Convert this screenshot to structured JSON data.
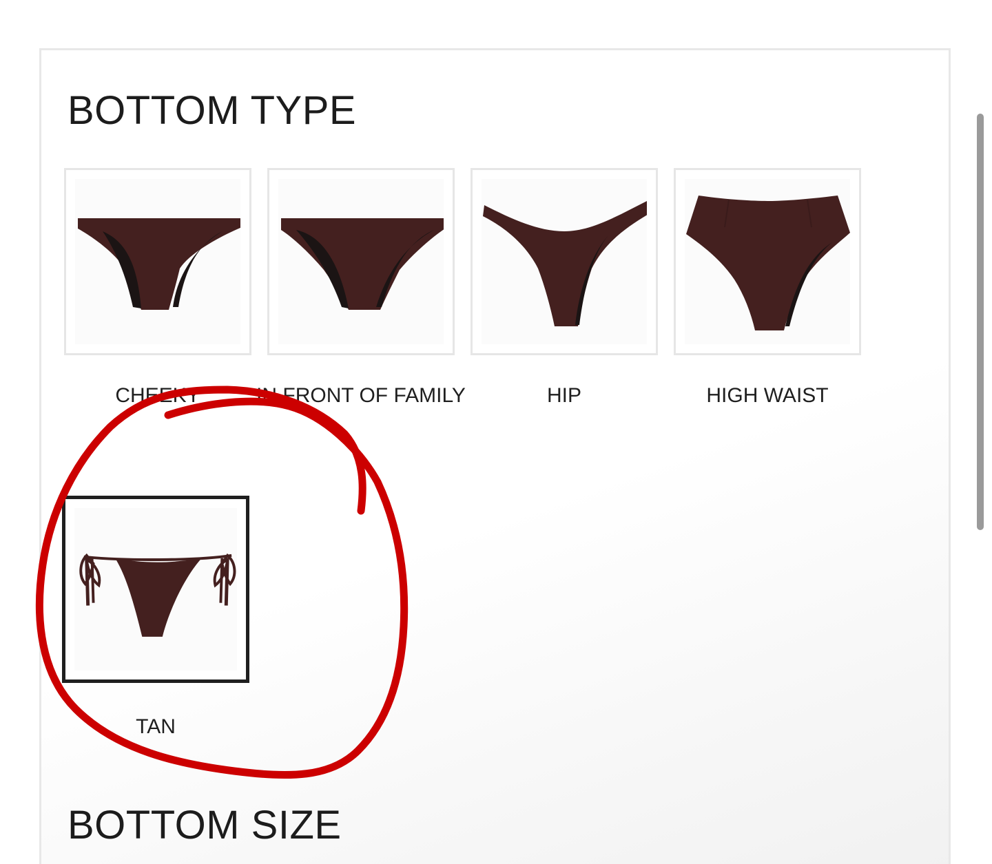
{
  "sections": {
    "bottom_type_title": "BOTTOM TYPE",
    "bottom_size_title": "BOTTOM SIZE"
  },
  "bottom_types": [
    {
      "label": "CHEEKY",
      "selected": false
    },
    {
      "label": "IN FRONT OF FAMILY",
      "selected": false
    },
    {
      "label": "HIP",
      "selected": false
    },
    {
      "label": "HIGH WAIST",
      "selected": false
    },
    {
      "label": "TAN",
      "selected": true
    }
  ],
  "colors": {
    "garment": "#44201f",
    "garment_lining": "#1b1414",
    "selected_border": "#1f1f1f",
    "annotation_circle": "#cc0000"
  },
  "annotation": {
    "shape": "hand-drawn circle",
    "color": "red"
  }
}
